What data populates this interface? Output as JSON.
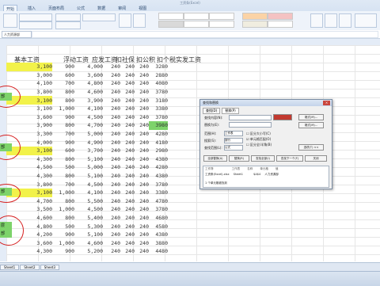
{
  "window": {
    "title": "工资条(Excel)"
  },
  "ribbon": {
    "tabs": [
      "开始",
      "插入",
      "页面布局",
      "公式",
      "数据",
      "审阅",
      "视图"
    ],
    "active_tab": 0
  },
  "formula_bar": {
    "name_box": "人力资源部"
  },
  "sheet": {
    "headers": [
      "基本工资",
      "浮动工资",
      "应发工资",
      "扣社保",
      "扣公积",
      "扣个税",
      "实发工资"
    ],
    "rows": [
      [
        "3,100",
        "900",
        "4,000",
        "240",
        "240",
        "240",
        "3280"
      ],
      [
        "3,000",
        "600",
        "3,600",
        "240",
        "240",
        "240",
        "2880"
      ],
      [
        "4,100",
        "700",
        "4,800",
        "240",
        "240",
        "240",
        "4080"
      ],
      [
        "3,800",
        "800",
        "4,600",
        "240",
        "240",
        "240",
        "3780"
      ],
      [
        "3,100",
        "800",
        "3,900",
        "240",
        "240",
        "240",
        "3180"
      ],
      [
        "3,100",
        "1,000",
        "4,100",
        "240",
        "240",
        "240",
        "3380"
      ],
      [
        "3,600",
        "900",
        "4,500",
        "240",
        "240",
        "240",
        "3780"
      ],
      [
        "3,900",
        "800",
        "4,700",
        "240",
        "240",
        "240",
        "3980"
      ],
      [
        "3,300",
        "700",
        "5,000",
        "240",
        "240",
        "240",
        "4280"
      ],
      [
        "4,000",
        "900",
        "4,900",
        "240",
        "240",
        "240",
        "4180"
      ],
      [
        "3,100",
        "600",
        "3,700",
        "240",
        "240",
        "240",
        "2980"
      ],
      [
        "4,300",
        "800",
        "5,100",
        "240",
        "240",
        "240",
        "4380"
      ],
      [
        "4,500",
        "500",
        "5,000",
        "240",
        "240",
        "240",
        "4280"
      ],
      [
        "4,300",
        "800",
        "5,100",
        "240",
        "240",
        "240",
        "4380"
      ],
      [
        "3,800",
        "700",
        "4,500",
        "240",
        "240",
        "240",
        "3780"
      ],
      [
        "3,100",
        "1,000",
        "4,100",
        "240",
        "240",
        "240",
        "3380"
      ],
      [
        "4,700",
        "800",
        "5,500",
        "240",
        "240",
        "240",
        "4780"
      ],
      [
        "3,500",
        "1,000",
        "4,500",
        "240",
        "240",
        "240",
        "3780"
      ],
      [
        "4,600",
        "800",
        "5,400",
        "240",
        "240",
        "240",
        "4680"
      ],
      [
        "4,800",
        "500",
        "5,300",
        "240",
        "240",
        "240",
        "4580"
      ],
      [
        "4,200",
        "900",
        "5,100",
        "240",
        "240",
        "240",
        "4380"
      ],
      [
        "3,600",
        "1,000",
        "4,600",
        "240",
        "240",
        "240",
        "3880"
      ],
      [
        "4,300",
        "900",
        "5,200",
        "240",
        "240",
        "240",
        "4480"
      ]
    ],
    "left_marks": [
      "部",
      "部",
      "部",
      "层",
      "部"
    ]
  },
  "dialog": {
    "title": "查找和替换",
    "tabs": [
      "查找(D)",
      "替换(P)"
    ],
    "fields": [
      {
        "label": "查找内容(N):",
        "value": ""
      },
      {
        "label": "替换为(E):",
        "value": ""
      }
    ],
    "options": [
      {
        "label": "范围(H):",
        "value": "工作表"
      },
      {
        "label": "搜索(S):",
        "value": "按行"
      },
      {
        "label": "查找范围(L):",
        "value": "公式"
      }
    ],
    "checks": [
      "区分大小写(C)",
      "单元格匹配(O)",
      "区分全/半角(B)"
    ],
    "buttons": [
      "全部替换(A)",
      "替换(R)",
      "查找全部(I)",
      "查找下一个(F)",
      "关闭"
    ],
    "format_buttons": [
      "格式(M)...",
      "选项(T) <<"
    ],
    "result_headers": [
      "工作簿",
      "工作表",
      "名称",
      "单元格",
      "值"
    ],
    "result_row": [
      "工资条(Excel).xlsx",
      "Sheet1",
      "",
      "$A$4",
      "人力资源部"
    ],
    "status": "1 个单元格被找到"
  },
  "sheet_tabs": [
    "Sheet1",
    "Sheet2",
    "Sheet3"
  ],
  "colors": {
    "highlight_yellow": "#f2f24a",
    "highlight_green": "#7dd36a",
    "annotation_red": "#d62020"
  }
}
